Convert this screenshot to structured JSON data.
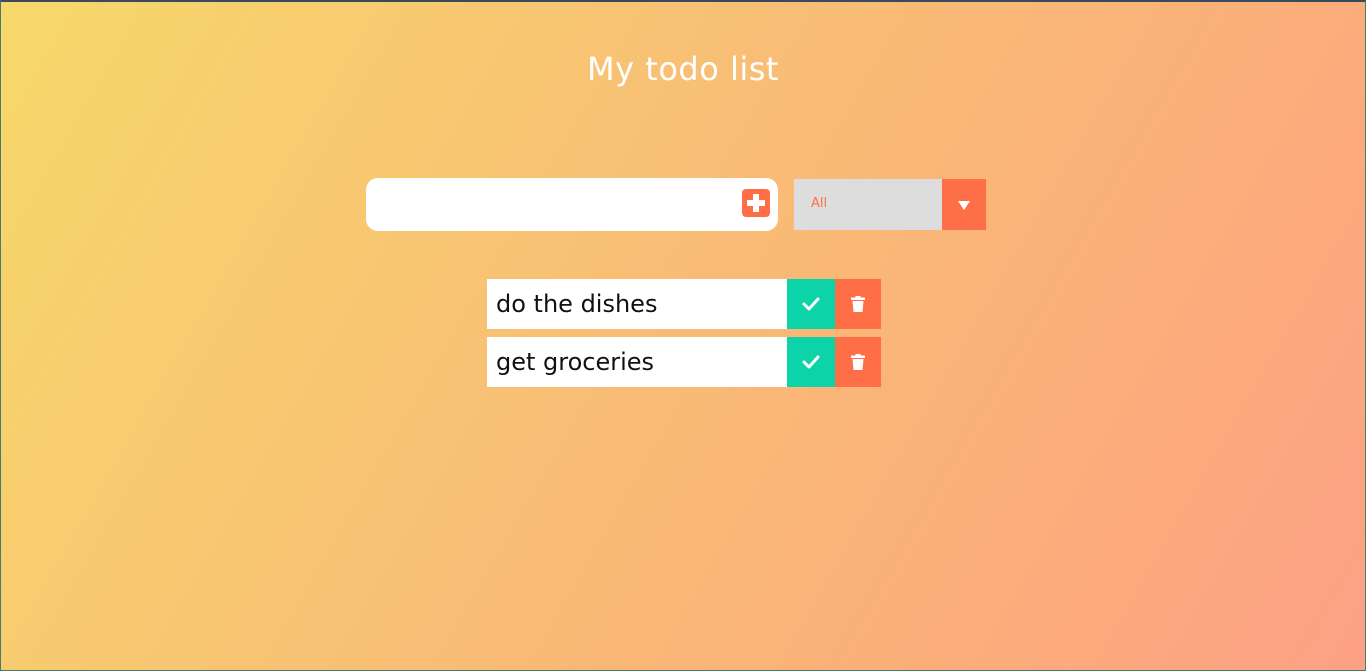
{
  "header": {
    "title": "My todo list"
  },
  "form": {
    "input_value": "",
    "input_placeholder": "",
    "add_icon": "plus-square-icon"
  },
  "filter": {
    "selected": "All",
    "arrow_icon": "caret-down-icon"
  },
  "todos": [
    {
      "text": "do the dishes"
    },
    {
      "text": "get groceries"
    }
  ],
  "colors": {
    "accent": "#ff6f47",
    "complete": "#0cd4a8",
    "filter_bg": "#dddddd",
    "gradient_start": "#f7d86a",
    "gradient_end": "#fda085"
  }
}
